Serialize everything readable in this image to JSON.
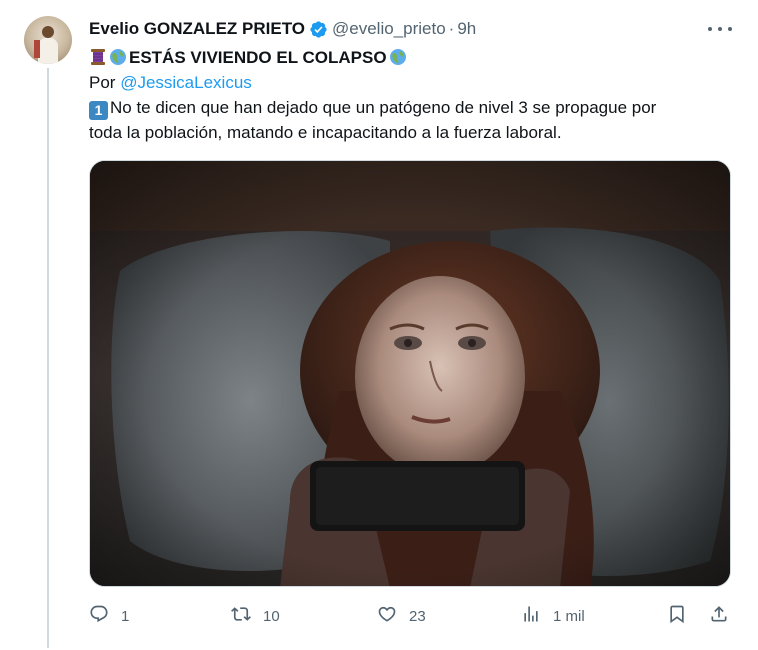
{
  "tweet": {
    "author_name": "Evelio GONZALEZ PRIETO",
    "handle": "@evelio_prieto",
    "separator": "·",
    "time": "9h",
    "title_text": "ESTÁS VIVIENDO EL COLAPSO",
    "by_label": "Por ",
    "mention": "@JessicaLexicus",
    "number_badge": "1",
    "body_line1": "No te dicen que han dejado que un patógeno de nivel 3 se propague por",
    "body_line2": "toda la población, matando e incapacitando a la fuerza laboral."
  },
  "actions": {
    "replies": "1",
    "retweets": "10",
    "likes": "23",
    "views": "1 mil"
  },
  "icons": {
    "verified": "verified-badge-icon",
    "more": "more-horizontal-icon",
    "thread": "spool-thread-emoji",
    "globe": "globe-emoji",
    "reply": "reply-icon",
    "retweet": "retweet-icon",
    "like": "heart-icon",
    "views": "analytics-icon",
    "bookmark": "bookmark-icon",
    "share": "share-icon"
  },
  "colors": {
    "accent": "#1d9bf0",
    "muted": "#536471",
    "text": "#0f1419",
    "border": "#cfd9de"
  }
}
